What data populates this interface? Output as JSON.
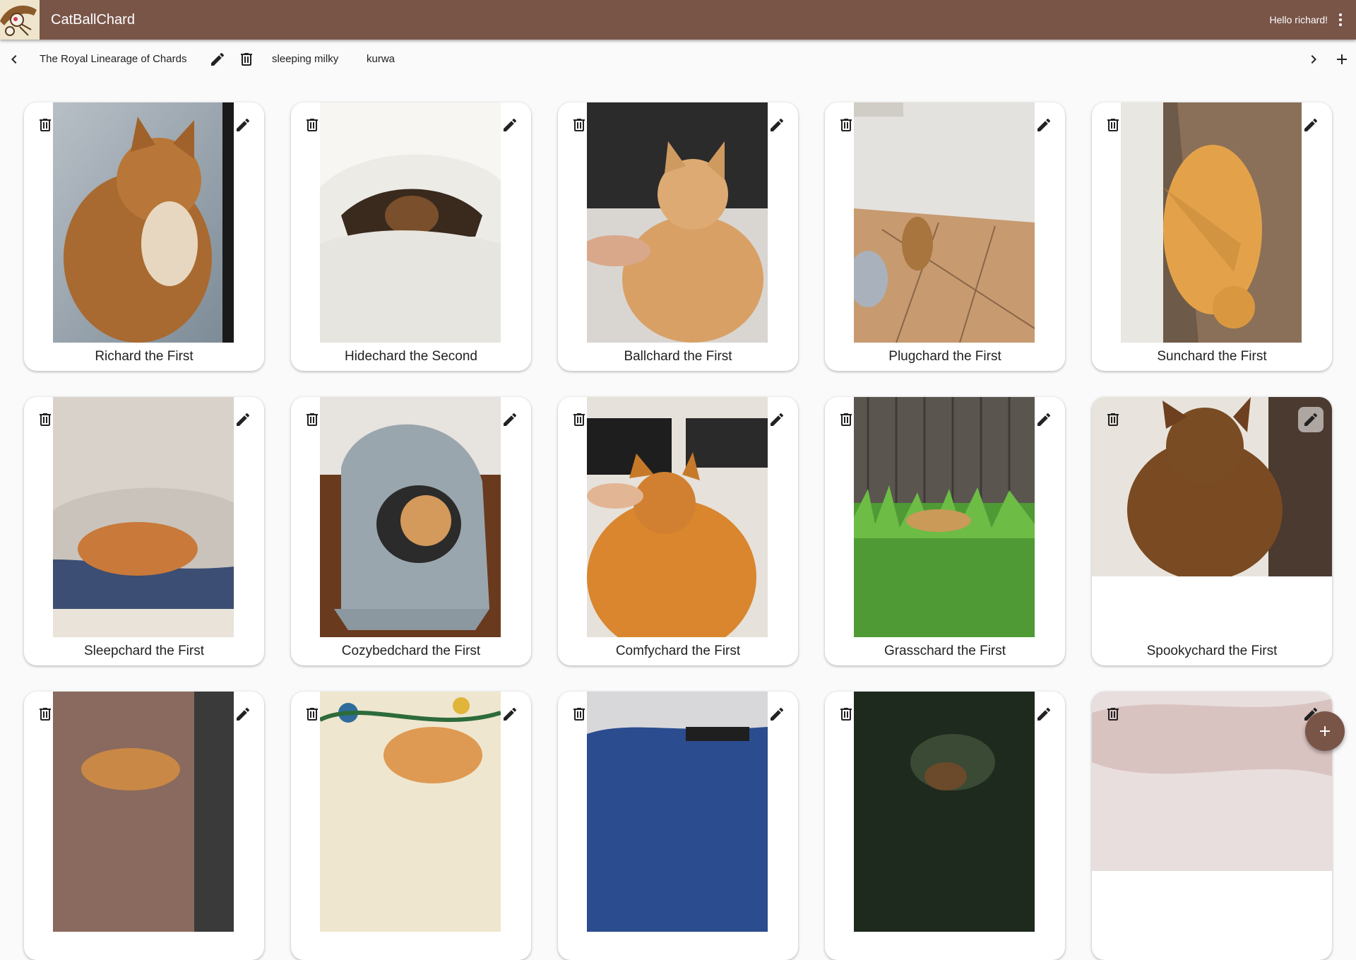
{
  "app": {
    "title": "CatBallChard",
    "greeting": "Hello richard!"
  },
  "tabs": {
    "items": [
      {
        "label": "The Royal Linearage of Chards",
        "selected": true
      },
      {
        "label": "sleeping milky",
        "selected": false
      },
      {
        "label": "kurwa",
        "selected": false
      }
    ]
  },
  "cards": [
    {
      "name": "Richard the First"
    },
    {
      "name": "Hidechard the Second"
    },
    {
      "name": "Ballchard the First"
    },
    {
      "name": "Plugchard the First"
    },
    {
      "name": "Sunchard the First"
    },
    {
      "name": "Sleepchard the First"
    },
    {
      "name": "Cozybedchard the First"
    },
    {
      "name": "Comfychard the First"
    },
    {
      "name": "Grasschard the First"
    },
    {
      "name": "Spookychard the First"
    },
    {
      "name": ""
    },
    {
      "name": ""
    },
    {
      "name": ""
    },
    {
      "name": ""
    },
    {
      "name": ""
    }
  ],
  "icons": {
    "back": "chevron-left-icon",
    "forward": "chevron-right-icon",
    "add_tab": "plus-icon",
    "edit": "pencil-icon",
    "delete": "trash-icon",
    "menu": "more-vert-icon",
    "fab": "plus-icon"
  },
  "colors": {
    "app_bar": "#795548",
    "background": "#fafafa",
    "card": "#ffffff",
    "fab": "#795548"
  }
}
